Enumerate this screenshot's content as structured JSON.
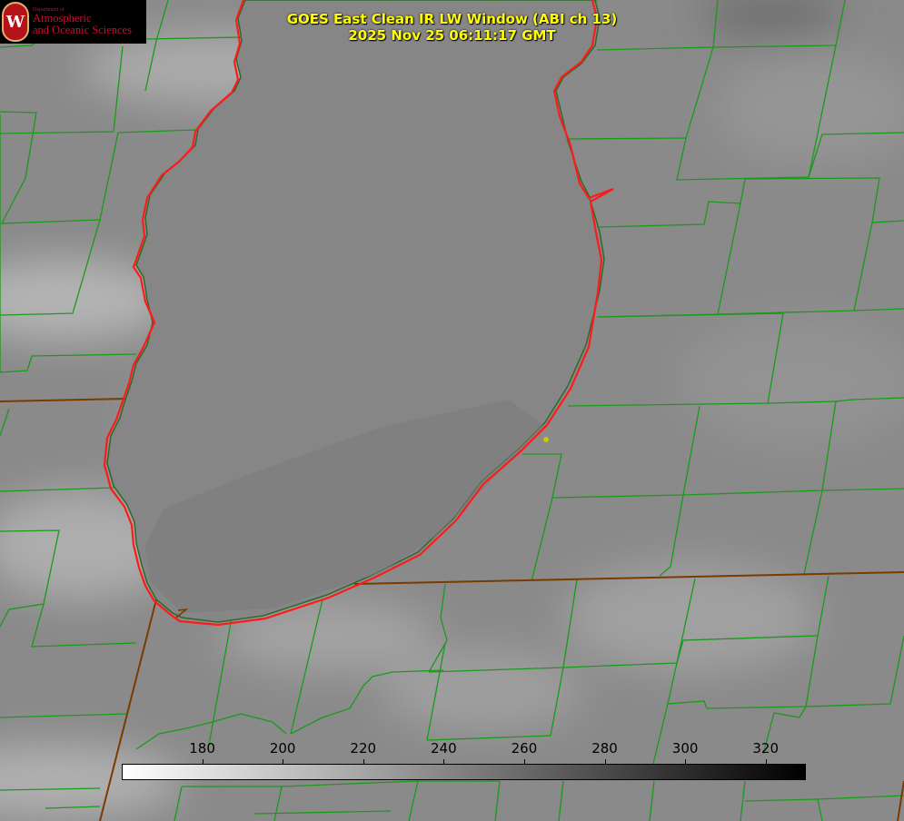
{
  "title_line1": "GOES East Clean IR LW Window (ABI ch 13)",
  "title_line2": "2025 Nov 25 06:11:17 GMT",
  "logo": {
    "dept": "Department of",
    "line1": "Atmospheric",
    "line2": "and Oceanic Sciences",
    "seal_letter": "W"
  },
  "colorbar": {
    "min": 160,
    "max": 330,
    "ticks": [
      "180",
      "200",
      "220",
      "240",
      "260",
      "280",
      "300",
      "320"
    ],
    "color_low": "#ffffff",
    "color_high": "#000000"
  },
  "colors": {
    "coastline": "#ff1a1a",
    "county_border": "#1a9a1a",
    "state_border": "#7a3a00",
    "marker": "#d4c400",
    "title": "#ffff00"
  },
  "map_icon": "county-boundary-map"
}
